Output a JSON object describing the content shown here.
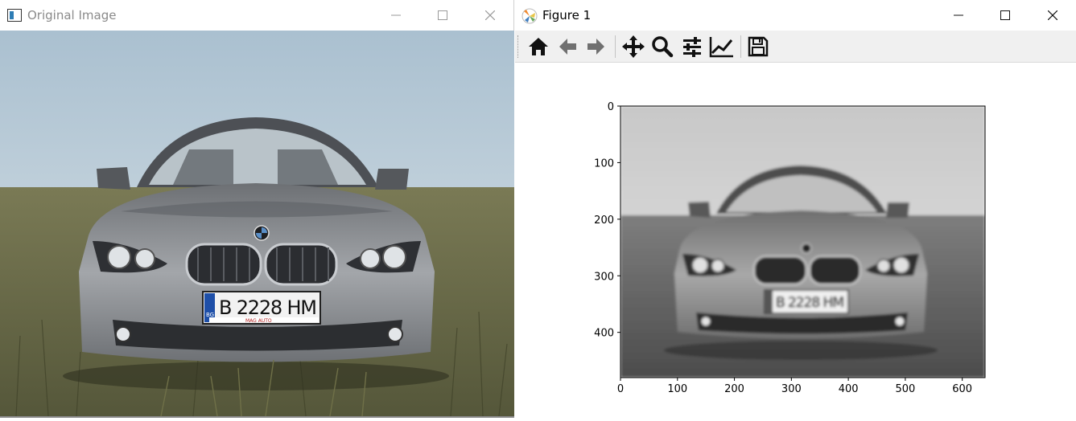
{
  "left_window": {
    "title": "Original Image",
    "plate_text": "B 2228 HM",
    "plate_country": "BG",
    "dealer_strip": "MAG AUTO"
  },
  "right_window": {
    "title": "Figure 1",
    "plate_text": "B 2228 HM",
    "toolbar": [
      "home-icon",
      "back-arrow-icon",
      "forward-arrow-icon",
      "pan-icon",
      "zoom-icon",
      "configure-subplots-icon",
      "edit-axes-icon",
      "save-icon"
    ]
  },
  "chart_data": {
    "type": "image",
    "colormap": "gray",
    "xlim": [
      0,
      640
    ],
    "ylim": [
      480,
      0
    ],
    "x_ticks": [
      0,
      100,
      200,
      300,
      400,
      500,
      600
    ],
    "y_ticks": [
      0,
      100,
      200,
      300,
      400
    ],
    "x_tick_labels": [
      "0",
      "100",
      "200",
      "300",
      "400",
      "500",
      "600"
    ],
    "y_tick_labels": [
      "0",
      "100",
      "200",
      "300",
      "400"
    ],
    "title": "",
    "xlabel": "",
    "ylabel": ""
  },
  "colors": {
    "sky": "#c9d6df",
    "grass": "#6b6a45",
    "car_body": "#8f9296",
    "window_active_text": "#000000",
    "window_inactive_text": "#8a8a8a"
  }
}
